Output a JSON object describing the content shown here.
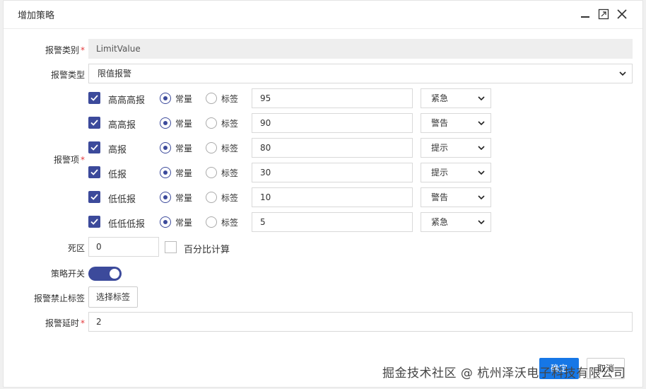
{
  "dialog": {
    "title": "增加策略"
  },
  "form": {
    "alarm_class": {
      "label": "报警类别",
      "value": "LimitValue"
    },
    "alarm_type": {
      "label": "报警类型",
      "value": "限值报警"
    },
    "alarm_items_label": "报警项",
    "alarm_items": [
      {
        "name": "高高高报",
        "checked": true,
        "mode": "constant",
        "value": "95",
        "level": "紧急"
      },
      {
        "name": "高高报",
        "checked": true,
        "mode": "constant",
        "value": "90",
        "level": "警告"
      },
      {
        "name": "高报",
        "checked": true,
        "mode": "constant",
        "value": "80",
        "level": "提示"
      },
      {
        "name": "低报",
        "checked": true,
        "mode": "constant",
        "value": "30",
        "level": "提示"
      },
      {
        "name": "低低报",
        "checked": true,
        "mode": "constant",
        "value": "10",
        "level": "警告"
      },
      {
        "name": "低低低报",
        "checked": true,
        "mode": "constant",
        "value": "5",
        "level": "紧急"
      }
    ],
    "radio_constant_label": "常量",
    "radio_tag_label": "标签",
    "dead_zone": {
      "label": "死区",
      "value": "0",
      "percent_label": "百分比计算",
      "percent_checked": false
    },
    "strategy_switch": {
      "label": "策略开关",
      "on": true
    },
    "alarm_forbid_tag": {
      "label": "报警禁止标签",
      "button": "选择标签"
    },
    "alarm_delay": {
      "label": "报警延时",
      "value": "2"
    }
  },
  "footer": {
    "ok_label": "确定",
    "cancel_label": "取消"
  },
  "watermark": "掘金技术社区 @ 杭州泽沃电子科技有限公司",
  "colors": {
    "accent": "#3c4a9b",
    "primary_button": "#1677e6",
    "required": "#e4393c"
  }
}
